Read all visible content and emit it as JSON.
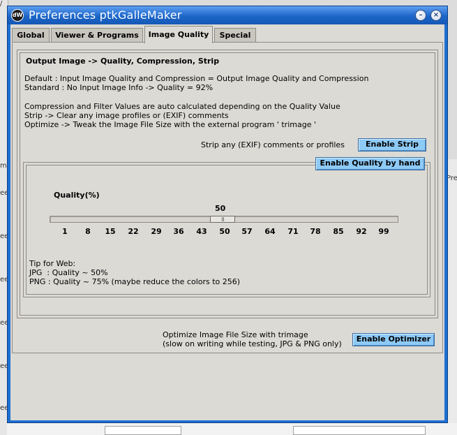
{
  "background": {
    "left_fragments": [
      "/",
      "o",
      "me",
      "ee",
      "ee",
      "ee",
      "ee",
      "ee",
      "ee",
      "ee"
    ],
    "right_fragment": "Pre"
  },
  "window": {
    "icon_label": "dW",
    "title": "Preferences ptkGalleMaker",
    "minimize_glyph": "–",
    "close_glyph": "×"
  },
  "tabs": [
    {
      "label": "Global",
      "active": false
    },
    {
      "label": "Viewer & Programs",
      "active": false
    },
    {
      "label": "Image Quality",
      "active": true
    },
    {
      "label": "Special",
      "active": false
    }
  ],
  "output": {
    "title": "Output Image -> Quality, Compression, Strip",
    "info_lines": [
      "Default : Input Image Quality and Compression = Output Image Quality and Compression",
      "Standard : No Input Image Info -> Quality = 92%",
      "Compression and Filter Values are auto calculated depending on the Quality Value",
      "Strip -> Clear any image profiles or (EXIF) comments",
      "Optimize -> Tweak the Image File Size with the external program ' trimage '"
    ],
    "strip_label": "Strip any (EXIF) comments or profiles",
    "strip_button": "Enable Strip",
    "quality_button": "Enable Quality by hand",
    "scale": {
      "title": "Quality(%)",
      "value": 50,
      "min": 1,
      "max": 99,
      "ticks": [
        "1",
        "8",
        "15",
        "22",
        "29",
        "36",
        "43",
        "50",
        "57",
        "64",
        "71",
        "78",
        "85",
        "92",
        "99"
      ]
    },
    "tip_lines": [
      "Tip for Web:",
      "JPG  : Quality ~ 50%",
      "PNG : Quality ~ 75% (maybe reduce the colors to 256)"
    ]
  },
  "optimize": {
    "label_lines": [
      "Optimize Image File Size with trimage",
      "(slow on writing while testing, JPG & PNG only)"
    ],
    "button": "Enable Optimizer"
  },
  "colors": {
    "titlebar": "#1c66c8",
    "button_accent": "#8ecaf6",
    "panel": "#dcdad5"
  }
}
